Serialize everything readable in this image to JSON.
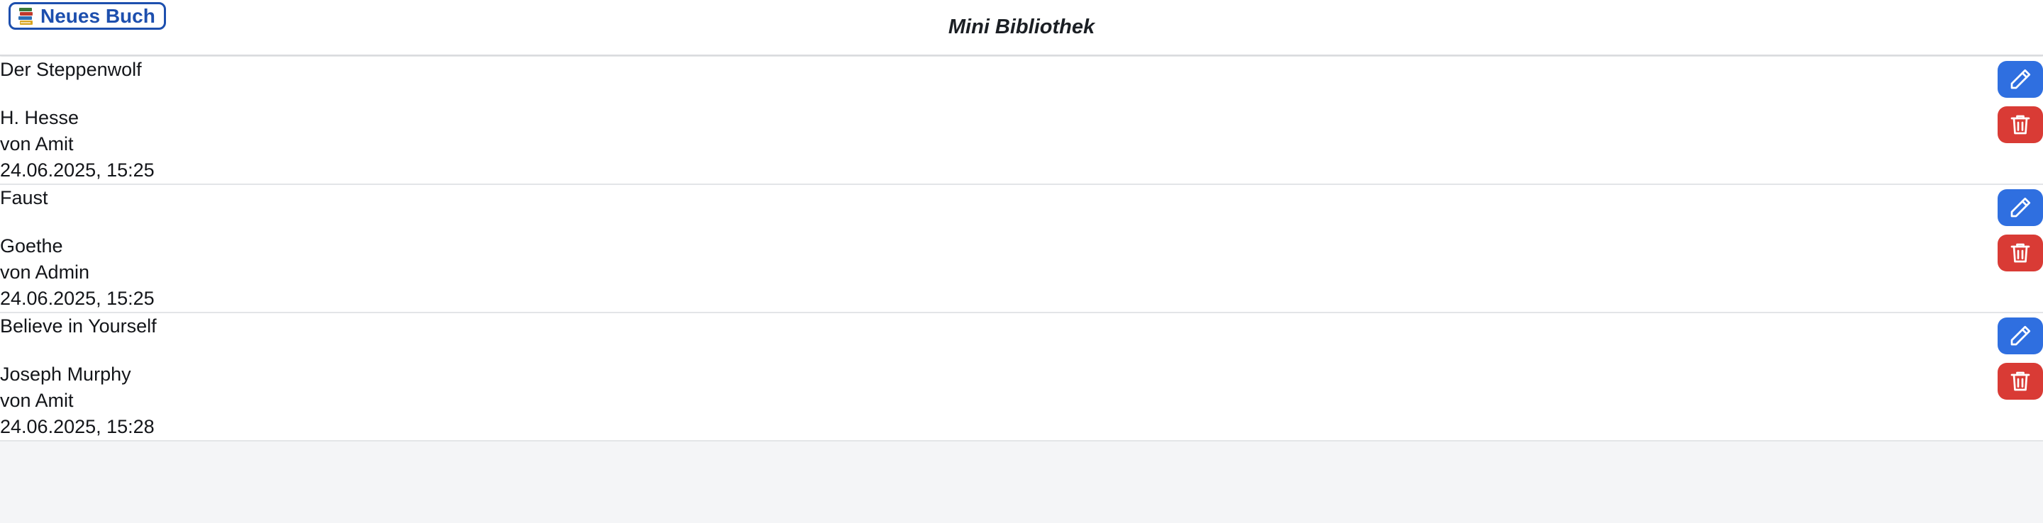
{
  "header": {
    "new_book_label": "Neues Buch",
    "new_book_icon": "books-icon",
    "title": "Mini Bibliothek"
  },
  "books": [
    {
      "title": "Der Steppenwolf",
      "author": "H. Hesse",
      "owner": "von Amit",
      "timestamp": "24.06.2025, 15:25"
    },
    {
      "title": "Faust",
      "author": "Goethe",
      "owner": "von Admin",
      "timestamp": "24.06.2025, 15:25"
    },
    {
      "title": "Believe in Yourself",
      "author": "Joseph Murphy",
      "owner": "von Amit",
      "timestamp": "24.06.2025, 15:28"
    }
  ],
  "icons": {
    "edit": "pencil-icon",
    "delete": "trash-icon"
  },
  "colors": {
    "accent": "#1d4fae",
    "edit_button": "#2f6fe0",
    "delete_button": "#d93b35",
    "background": "#f4f5f7"
  }
}
